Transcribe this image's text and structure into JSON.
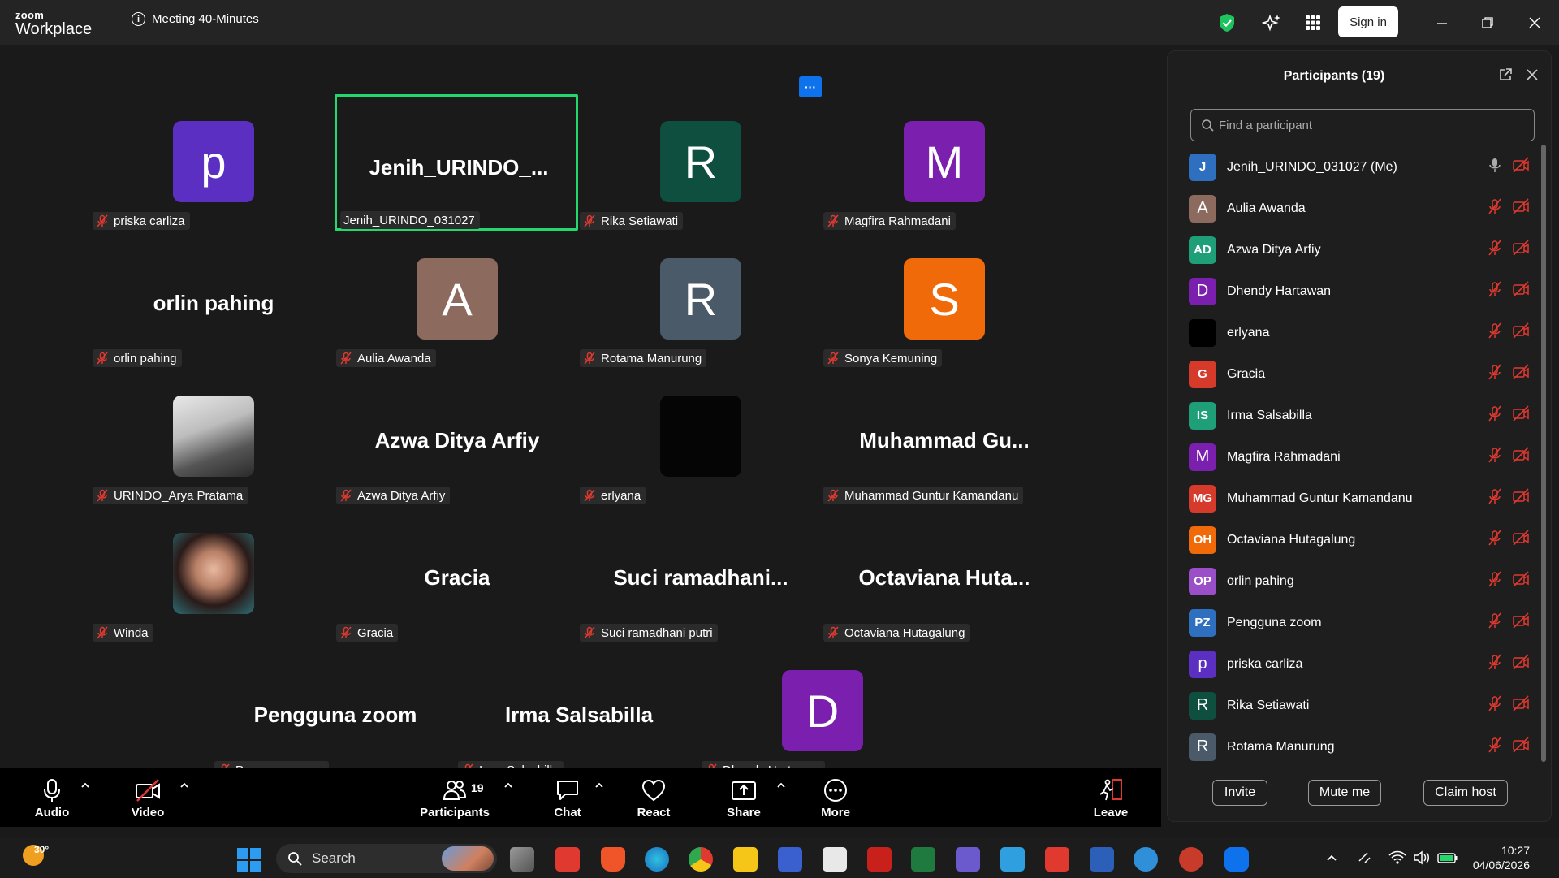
{
  "app": {
    "brand_small": "zoom",
    "brand_large": "Workplace",
    "meeting_title": "Meeting 40-Minutes",
    "sign_in_label": "Sign in"
  },
  "more_label": "···",
  "tiles": [
    {
      "name": "priska carliza",
      "initial": "p",
      "color": "#5b2fc2",
      "type": "avatar"
    },
    {
      "name": "Jenih_URINDO_031027",
      "big": "Jenih_URINDO_...",
      "type": "text",
      "active": true
    },
    {
      "name": "Rika Setiawati",
      "initial": "R",
      "color": "#0e4f3f",
      "type": "avatar"
    },
    {
      "name": "Magfira Rahmadani",
      "initial": "M",
      "color": "#7a1fae",
      "type": "avatar"
    },
    {
      "name": "orlin pahing",
      "big": "orlin pahing",
      "type": "text"
    },
    {
      "name": "Aulia Awanda",
      "initial": "A",
      "color": "#8d6a5e",
      "type": "avatar"
    },
    {
      "name": "Rotama Manurung",
      "initial": "R",
      "color": "#4a5a68",
      "type": "avatar"
    },
    {
      "name": "Sonya Kemuning",
      "initial": "S",
      "color": "#f06a0a",
      "type": "avatar"
    },
    {
      "name": "URINDO_Arya Pratama",
      "type": "photo",
      "photo": "skate"
    },
    {
      "name": "Azwa Ditya Arfiy",
      "big": "Azwa Ditya Arfiy",
      "type": "text"
    },
    {
      "name": "erlyana",
      "type": "black"
    },
    {
      "name": "Muhammad Guntur Kamandanu",
      "big": "Muhammad  Gu...",
      "type": "text"
    },
    {
      "name": "Winda",
      "type": "photo",
      "photo": "winda"
    },
    {
      "name": "Gracia",
      "big": "Gracia",
      "type": "text"
    },
    {
      "name": "Suci ramadhani putri",
      "big": "Suci  ramadhani...",
      "type": "text"
    },
    {
      "name": "Octaviana Hutagalung",
      "big": "Octaviana  Huta...",
      "type": "text"
    },
    {
      "name": "Pengguna zoom",
      "big": "Pengguna zoom",
      "type": "text"
    },
    {
      "name": "Irma Salsabilla",
      "big": "Irma Salsabilla",
      "type": "text"
    },
    {
      "name": "Dhendy Hartawan",
      "initial": "D",
      "color": "#7a1fae",
      "type": "avatar"
    }
  ],
  "toolbar": {
    "audio": "Audio",
    "video": "Video",
    "participants": "Participants",
    "participants_count": "19",
    "chat": "Chat",
    "react": "React",
    "share": "Share",
    "more": "More",
    "leave": "Leave"
  },
  "panel": {
    "title": "Participants (19)",
    "search_placeholder": "Find a participant",
    "participants": [
      {
        "name": "Jenih_URINDO_031027 (Me)",
        "initial": "J",
        "color": "#2f6fbf",
        "sm": true,
        "me": true
      },
      {
        "name": "Aulia Awanda",
        "initial": "A",
        "color": "#8d6a5e"
      },
      {
        "name": "Azwa Ditya Arfiy",
        "initial": "AD",
        "color": "#1f9f78",
        "sm": true
      },
      {
        "name": "Dhendy Hartawan",
        "initial": "D",
        "color": "#7a1fae"
      },
      {
        "name": "erlyana",
        "initial": "",
        "color": "#000000"
      },
      {
        "name": "Gracia",
        "initial": "G",
        "color": "#d63a2a",
        "sm": true
      },
      {
        "name": "Irma Salsabilla",
        "initial": "IS",
        "color": "#1f9f78",
        "sm": true
      },
      {
        "name": "Magfira Rahmadani",
        "initial": "M",
        "color": "#7a1fae"
      },
      {
        "name": "Muhammad Guntur Kamandanu",
        "initial": "MG",
        "color": "#d63a2a",
        "sm": true
      },
      {
        "name": "Octaviana Hutagalung",
        "initial": "OH",
        "color": "#f06a0a",
        "sm": true
      },
      {
        "name": "orlin pahing",
        "initial": "OP",
        "color": "#9a4fc8",
        "sm": true
      },
      {
        "name": "Pengguna zoom",
        "initial": "PZ",
        "color": "#2f6fbf",
        "sm": true
      },
      {
        "name": "priska carliza",
        "initial": "p",
        "color": "#5b2fc2"
      },
      {
        "name": "Rika Setiawati",
        "initial": "R",
        "color": "#0e4f3f"
      },
      {
        "name": "Rotama Manurung",
        "initial": "R",
        "color": "#4a5a68"
      }
    ],
    "invite": "Invite",
    "mute_me": "Mute me",
    "claim_host": "Claim host"
  },
  "taskbar": {
    "temperature": "30°",
    "search_label": "Search",
    "time": "10:27",
    "date": "04/06/2026"
  },
  "colors": {
    "active_border": "#23d96e",
    "accent": "#0e72ed",
    "muted_red": "#e0392f"
  }
}
